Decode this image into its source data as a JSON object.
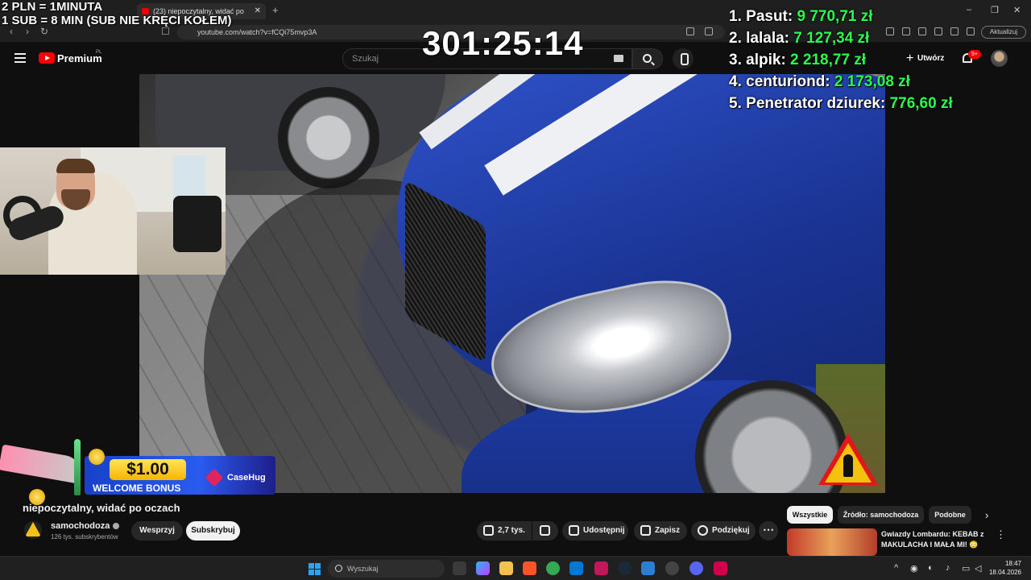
{
  "browser": {
    "tab_title": "(23) niepoczytalny, widać po",
    "tab_close": "✕",
    "new_tab": "+",
    "url": "youtube.com/watch?v=fCQi75mvp3A",
    "update_button": "Aktualizuj",
    "window_controls": [
      "–",
      "❐",
      "✕"
    ]
  },
  "youtube": {
    "logo_text": "Premium",
    "country_code": "PL",
    "search_placeholder": "Szukaj",
    "create_button": "Utwórz",
    "notification_count": "9+"
  },
  "stream_overlay": {
    "rule_line_1": "2 PLN = 1MINUTA",
    "rule_line_2": "1 SUB = 8 MIN (SUB NIE KRĘCI KOŁEM)",
    "timer": "301:25:14",
    "leaderboard": [
      {
        "rank": "1.",
        "name": "Pasut:",
        "amount": "9 770,71 zł"
      },
      {
        "rank": "2.",
        "name": "lalala:",
        "amount": "7 127,34 zł"
      },
      {
        "rank": "3.",
        "name": "alpik:",
        "amount": "2 218,77 zł"
      },
      {
        "rank": "4.",
        "name": "centuriond:",
        "amount": "2 173,08 zł"
      },
      {
        "rank": "5.",
        "name": "Penetrator dziurek:",
        "amount": "776,60 zł"
      }
    ],
    "bonus": {
      "amount": "$1.00",
      "label": "WELCOME BONUS",
      "brand": "CaseHug"
    }
  },
  "video": {
    "title": "niepoczytalny, widać po oczach",
    "channel_name": "samochodoza",
    "channel_subs": "126 tys. subskrybentów",
    "support_button": "Wesprzyj",
    "subscribe_button": "Subskrybuj",
    "like_count": "2,7 tys.",
    "share_button": "Udostępnij",
    "save_button": "Zapisz",
    "thanks_button": "Podziękuj",
    "more_button": "⋯"
  },
  "sidebar": {
    "chips": [
      "Wszystkie",
      "Źródło: samochodoza",
      "Podobne"
    ],
    "chevron": "›",
    "recommendation": {
      "title": "Gwiazdy Lombardu: KEBAB z MAKULACHA I MAŁA MI! 😳",
      "more": "⋮"
    }
  },
  "taskbar": {
    "search_placeholder": "Wyszukaj",
    "time": "18:47",
    "date": "18.04.2026"
  },
  "colors": {
    "leader_amount": "#2bff4d",
    "youtube_red": "#ff0000",
    "subscribe_bg": "#f1f1f1"
  }
}
